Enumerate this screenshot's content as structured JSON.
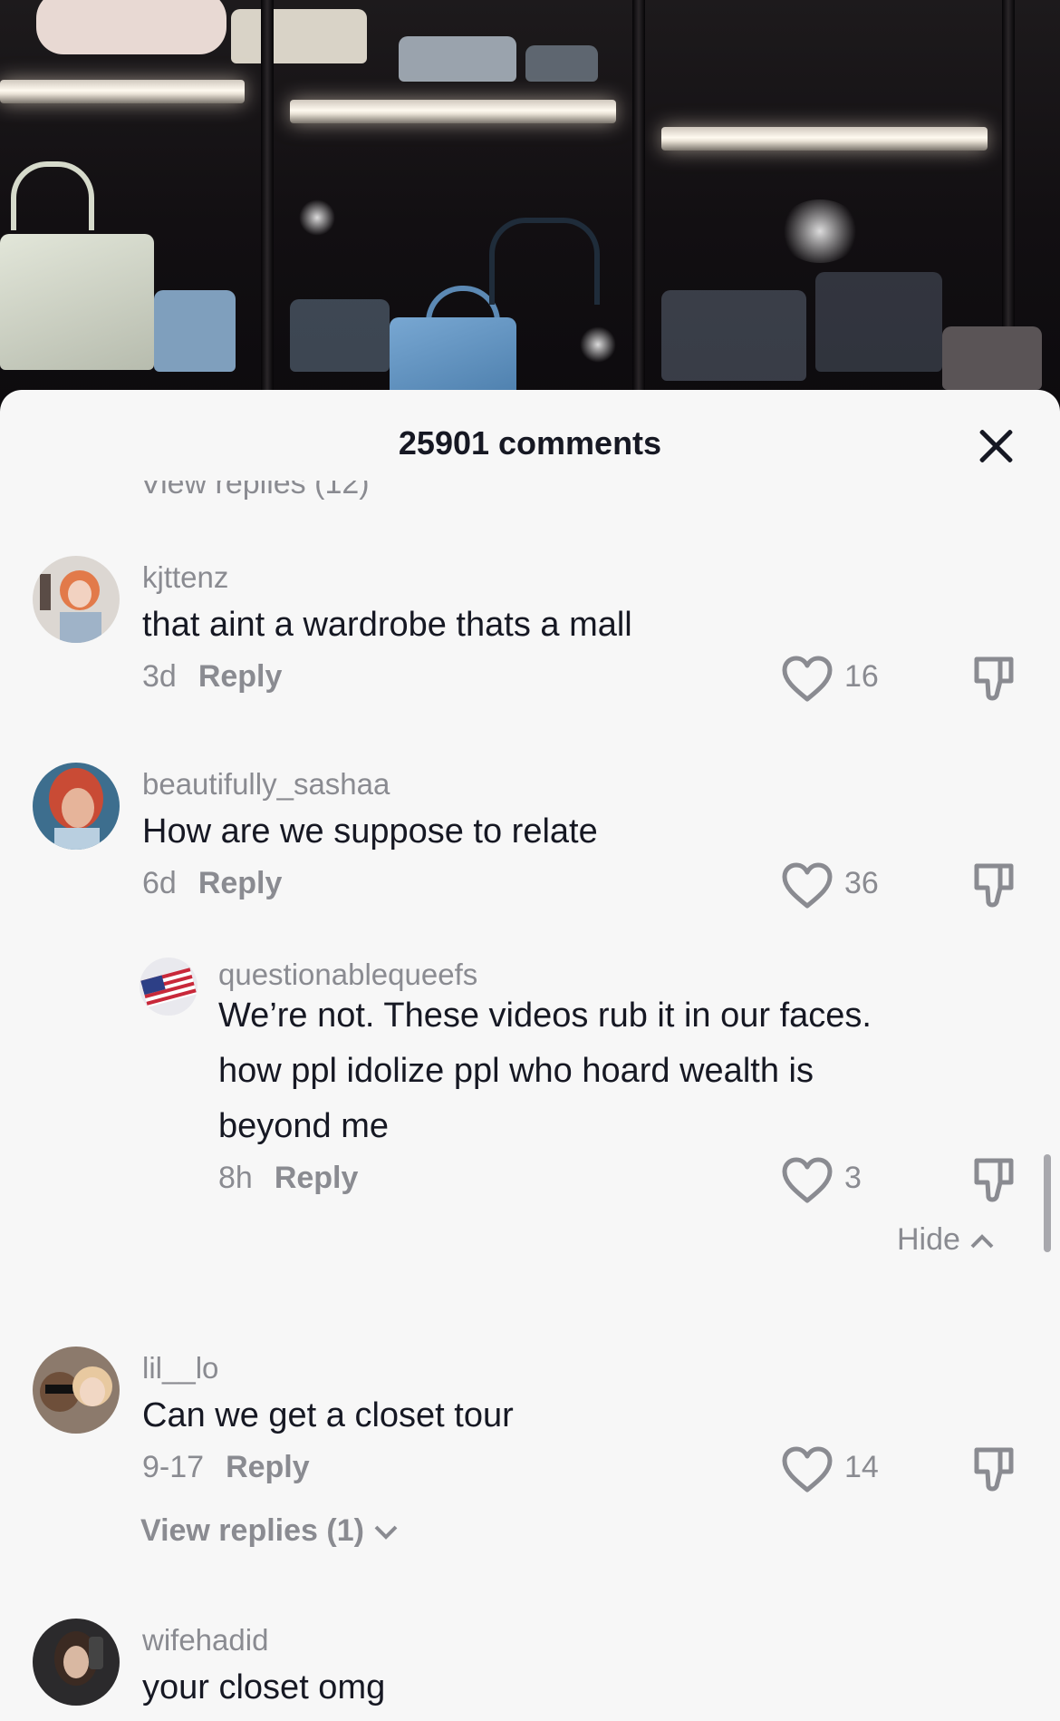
{
  "header": {
    "comment_count": "25901 comments"
  },
  "collapsed_above": "View replies (12)",
  "comments": [
    {
      "username": "kjttenz",
      "text": "that aint a wardrobe thats a mall",
      "time": "3d",
      "reply": "Reply",
      "likes": "16"
    },
    {
      "username": "beautifully_sashaa",
      "text": "How are we suppose to relate",
      "time": "6d",
      "reply": "Reply",
      "likes": "36"
    },
    {
      "username": "questionablequeefs",
      "text": "We’re not. These videos rub it in our faces. how ppl idolize ppl who hoard wealth is beyond me",
      "time": "8h",
      "reply": "Reply",
      "likes": "3"
    },
    {
      "username": "lil__lo",
      "text": "Can we get a closet tour",
      "time": "9-17",
      "reply": "Reply",
      "likes": "14"
    },
    {
      "username": "wifehadid",
      "text": "your closet omg"
    }
  ],
  "hide_label": "Hide",
  "view_replies_label": "View replies (1)",
  "colors": {
    "sheet_bg": "#f7f7f7",
    "text_primary": "#161823",
    "text_secondary": "#8a8b91"
  },
  "icons": [
    "close-icon",
    "heart-icon",
    "dislike-icon",
    "chevron-up-icon",
    "chevron-down-icon"
  ]
}
